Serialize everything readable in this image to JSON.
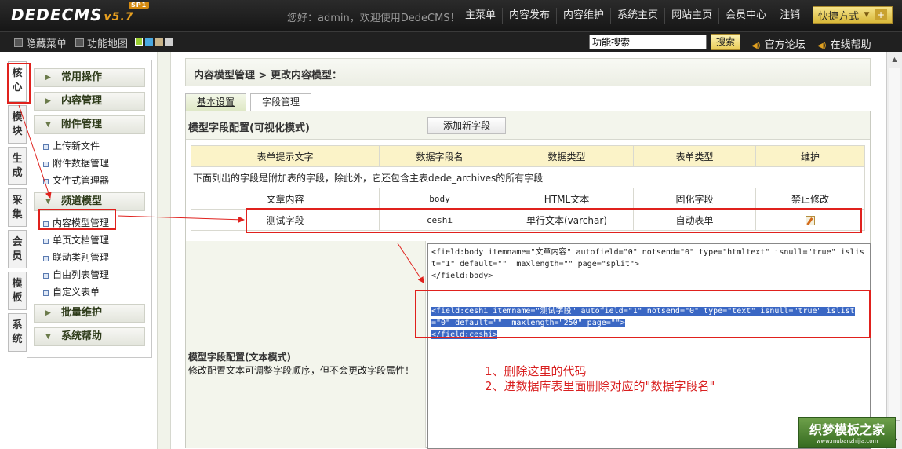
{
  "app": {
    "logo": "DEDECMS",
    "version": "v5.7",
    "sp": "SP1"
  },
  "header": {
    "welcome": "您好：admin，欢迎使用DedeCMS！",
    "nav": [
      "主菜单",
      "内容发布",
      "内容维护",
      "系统主页",
      "网站主页",
      "会员中心",
      "注销"
    ],
    "quick": "快捷方式"
  },
  "subbar": {
    "hide_menu": "隐藏菜单",
    "func_map": "功能地图",
    "search_value": "功能搜索",
    "search_button": "搜索",
    "forum": "官方论坛",
    "help": "在线帮助"
  },
  "sidebar": {
    "vtabs": [
      "核心",
      "模块",
      "生成",
      "采集",
      "会员",
      "模板",
      "系统"
    ],
    "groups": [
      {
        "label": "常用操作",
        "items": []
      },
      {
        "label": "内容管理",
        "items": []
      },
      {
        "label": "附件管理",
        "items": [
          "上传新文件",
          "附件数据管理",
          "文件式管理器"
        ]
      },
      {
        "label": "频道模型",
        "items": [
          "内容模型管理",
          "单页文档管理",
          "联动类别管理",
          "自由列表管理",
          "自定义表单"
        ]
      },
      {
        "label": "批量维护",
        "items": []
      },
      {
        "label": "系统帮助",
        "items": []
      }
    ]
  },
  "main": {
    "breadcrumb": "内容模型管理 > 更改内容模型：",
    "tabs": [
      "基本设置",
      "字段管理"
    ],
    "section_title": "模型字段配置(可视化模式)",
    "add_field": "添加新字段",
    "table": {
      "headers": [
        "表单提示文字",
        "数据字段名",
        "数据类型",
        "表单类型",
        "维护"
      ],
      "note": "下面列出的字段是附加表的字段，除此外，它还包含主表dede_archives的所有字段",
      "rows": [
        [
          "文章内容",
          "body",
          "HTML文本",
          "固化字段",
          "禁止修改"
        ],
        [
          "测试字段",
          "ceshi",
          "单行文本(varchar)",
          "自动表单",
          ""
        ]
      ]
    },
    "text_mode_title": "模型字段配置(文本模式)",
    "text_mode_desc": "修改配置文本可调整字段顺序，但不会更改字段属性！",
    "code_normal": "<field:body itemname=\"文章内容\" autofield=\"0\" notsend=\"0\" type=\"htmltext\" isnull=\"true\" islist=\"1\" default=\"\"  maxlength=\"\" page=\"split\">\n</field:body>\n\n\n",
    "code_selected": "<field:ceshi itemname=\"测试字段\" autofield=\"1\" notsend=\"0\" type=\"text\" isnull=\"true\" islist=\"0\" default=\"\"  maxlength=\"250\" page=\"\">\n</field:ceshi>",
    "instructions": [
      "1、删除这里的代码",
      "2、进数据库表里面删除对应的\"数据字段名\""
    ]
  },
  "watermark": {
    "title": "织梦模板之家",
    "url": "www.mubanzhijia.com"
  },
  "colors": {
    "annotation_red": "#e0211d",
    "selection_blue": "#3a67c4",
    "accent_gold": "#e8a020"
  }
}
